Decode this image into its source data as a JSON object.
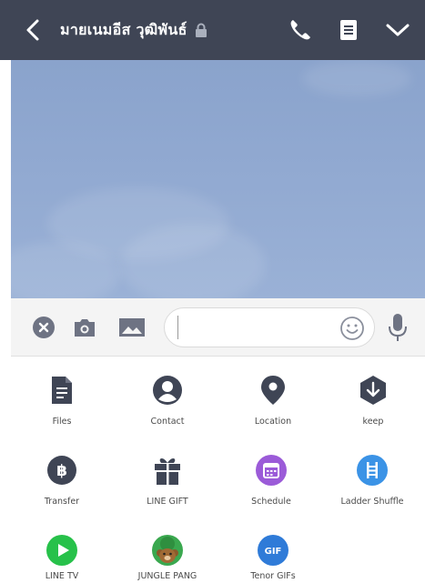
{
  "header": {
    "title": "มายเนมอีส วุฒิพันธ์",
    "icons": {
      "back": "chevron-left-icon",
      "lock": "lock-icon",
      "phone": "phone-icon",
      "notes": "notes-icon",
      "menu": "chevron-down-icon"
    }
  },
  "input_bar": {
    "value": "",
    "icons": [
      "close-icon",
      "camera-icon",
      "image-icon",
      "emoji-icon",
      "microphone-icon"
    ]
  },
  "features": [
    {
      "label": "Files",
      "icon": "file-icon"
    },
    {
      "label": "Contact",
      "icon": "contact-icon"
    },
    {
      "label": "Location",
      "icon": "location-pin-icon"
    },
    {
      "label": "keep",
      "icon": "keep-icon"
    },
    {
      "label": "Transfer",
      "icon": "baht-transfer-icon"
    },
    {
      "label": "LINE GIFT",
      "icon": "gift-icon"
    },
    {
      "label": "Schedule",
      "icon": "calendar-icon"
    },
    {
      "label": "Ladder Shuffle",
      "icon": "ladder-icon"
    },
    {
      "label": "LINE TV",
      "icon": "play-icon"
    },
    {
      "label": "JUNGLE PANG",
      "icon": "jungle-pang-icon"
    },
    {
      "label": "Tenor GIFs",
      "icon": "gif-icon"
    }
  ],
  "colors": {
    "header_bg": "#3f4555",
    "icon_dark": "#3f4555",
    "schedule_purple": "#9b5bd8",
    "ladder_blue": "#3b93e6",
    "linetv_green": "#27c14a",
    "tenor_blue": "#2f7bd8"
  },
  "gif_text": "GIF"
}
